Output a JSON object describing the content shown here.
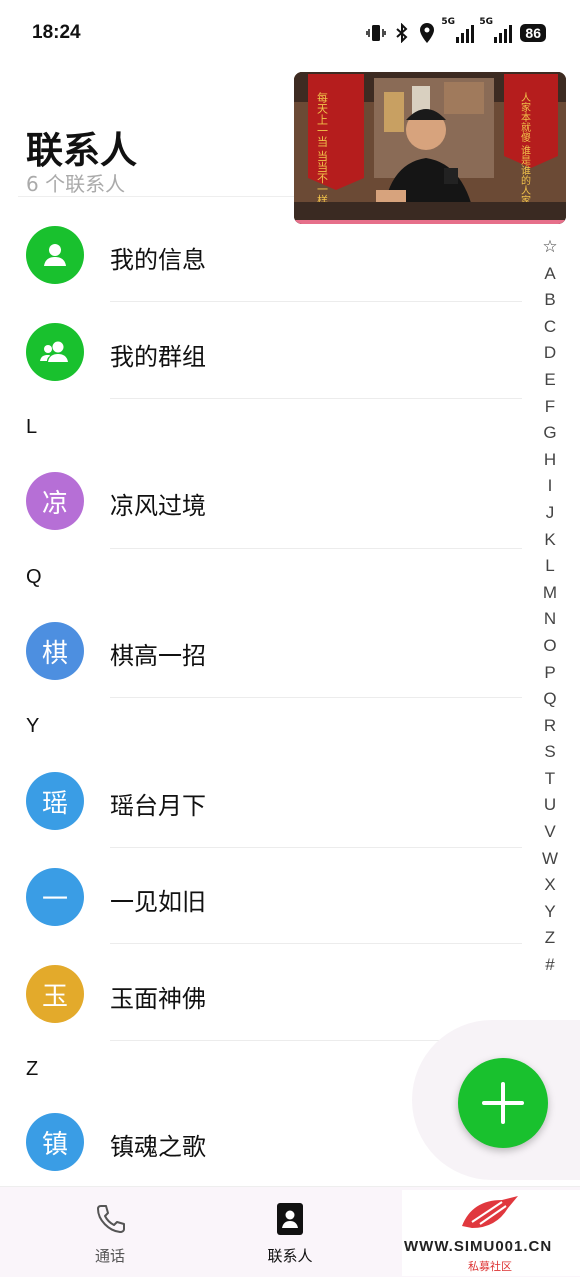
{
  "status_bar": {
    "time": "18:24",
    "signal1_label": "5G",
    "signal2_label": "5G",
    "battery": "86"
  },
  "header": {
    "title": "联系人",
    "subtitle": "6 个联系人"
  },
  "pip": {
    "banner_left_text": "每天上一当 当当不一样",
    "banner_right_text": "人家本就傻 谁是谁的人家"
  },
  "contacts": {
    "my_info": {
      "label": "我的信息",
      "color": "#19c12e"
    },
    "my_groups": {
      "label": "我的群组",
      "color": "#19c12e"
    },
    "section_l": "L",
    "c1": {
      "avatar": "凉",
      "name": "凉风过境",
      "color": "#b66fd6"
    },
    "section_q": "Q",
    "c2": {
      "avatar": "棋",
      "name": "棋高一招",
      "color": "#4d8fe0"
    },
    "section_y": "Y",
    "c3": {
      "avatar": "瑶",
      "name": "瑶台月下",
      "color": "#3a9de5"
    },
    "c4": {
      "avatar": "一",
      "name": "一见如旧",
      "color": "#3a9de5"
    },
    "c5": {
      "avatar": "玉",
      "name": "玉面神佛",
      "color": "#e3aa2b"
    },
    "section_z": "Z",
    "c6": {
      "avatar": "镇",
      "name": "镇魂之歌",
      "color": "#3a9de5"
    }
  },
  "index": [
    "☆",
    "A",
    "B",
    "C",
    "D",
    "E",
    "F",
    "G",
    "H",
    "I",
    "J",
    "K",
    "L",
    "M",
    "N",
    "O",
    "P",
    "Q",
    "R",
    "S",
    "T",
    "U",
    "V",
    "W",
    "X",
    "Y",
    "Z",
    "#"
  ],
  "bottom_nav": {
    "calls_label": "通话",
    "contacts_label": "联系人"
  },
  "watermark": {
    "site": "WWW.SIMU001.CN",
    "name": "私募社区"
  },
  "colors": {
    "accent": "#19c12e"
  }
}
